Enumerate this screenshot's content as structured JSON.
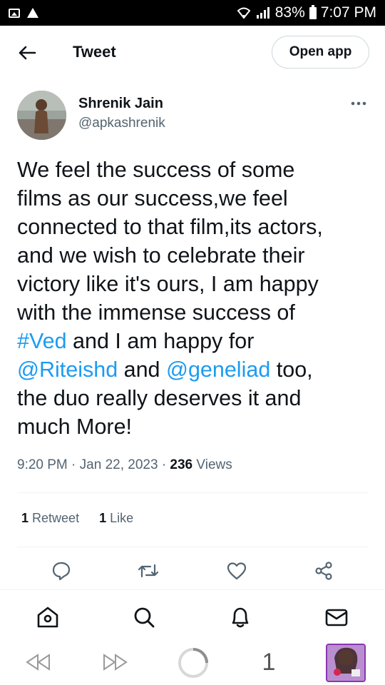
{
  "status_bar": {
    "left_icons": [
      "image-icon",
      "warning-icon"
    ],
    "battery": "83%",
    "time": "7:07 PM"
  },
  "header": {
    "title": "Tweet",
    "open_app_label": "Open app"
  },
  "tweet": {
    "author_name": "Shrenik Jain",
    "author_handle": "@apkashrenik",
    "text_lines": [
      [
        "We feel the success of some"
      ],
      [
        "films as our success,we feel"
      ],
      [
        "connected to that film,its actors,"
      ],
      [
        "and we wish to celebrate their"
      ],
      [
        "victory like it's ours, I am happy"
      ],
      [
        "with the immense success of"
      ],
      [
        "#Ved",
        " and I am happy for"
      ],
      [
        "@Riteishd",
        " and ",
        "@geneliad",
        " too,"
      ],
      [
        "the duo really deserves it and"
      ],
      [
        "much More!"
      ]
    ],
    "hashtag": "#Ved",
    "mention_1": "@Riteishd",
    "mention_2": "@geneliad",
    "time": "9:20 PM",
    "date": "Jan 22, 2023",
    "views_count": "236",
    "views_label": "Views",
    "retweet_count": "1",
    "retweet_label": "Retweet",
    "like_count": "1",
    "like_label": "Like"
  },
  "actions": [
    "reply-icon",
    "retweet-icon",
    "like-icon",
    "share-icon"
  ],
  "bottom_nav": [
    "home-icon",
    "search-icon",
    "notifications-icon",
    "messages-icon"
  ],
  "browser_bar": {
    "tab_count": "1"
  },
  "colors": {
    "link": "#1d9bf0",
    "text": "#0f1419",
    "secondary": "#536471",
    "divider": "#eff3f4"
  }
}
